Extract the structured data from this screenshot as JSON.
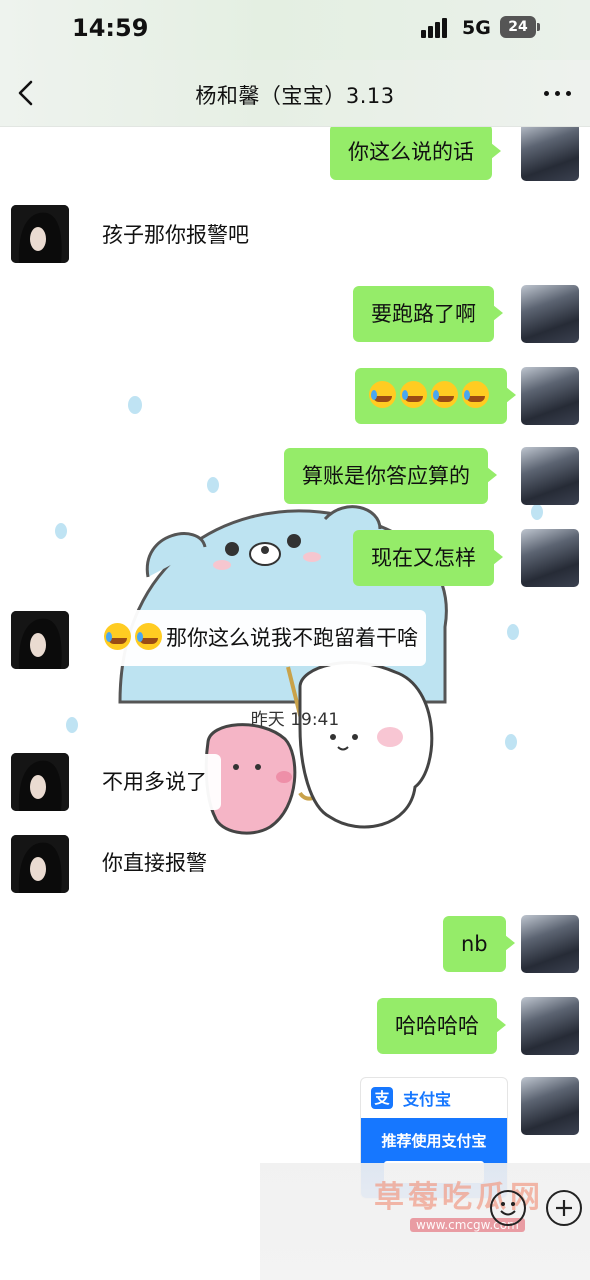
{
  "status_bar": {
    "time": "14:59",
    "network": "5G",
    "battery": "24"
  },
  "nav": {
    "title": "杨和馨（宝宝）3.13",
    "back_icon": "chevron-left-icon",
    "more_icon": "more-dots-icon"
  },
  "messages": [
    {
      "from": "me",
      "text": "你这么说的话"
    },
    {
      "from": "other",
      "text": "孩子那你报警吧"
    },
    {
      "from": "me",
      "text": "要跑路了啊"
    },
    {
      "from": "me",
      "text": "",
      "emojis": 4,
      "emoji_icon": "face-with-tears-of-joy-icon"
    },
    {
      "from": "me",
      "text": "算账是你答应算的"
    },
    {
      "from": "me",
      "text": "现在又怎样"
    },
    {
      "from": "other",
      "text": "那你这么说我不跑留着干啥",
      "emojis": 2,
      "emoji_icon": "face-with-tears-of-joy-icon"
    },
    {
      "from": "other",
      "text": "不用多说了"
    },
    {
      "from": "other",
      "text": "你直接报警"
    },
    {
      "from": "me",
      "text": "nb"
    },
    {
      "from": "me",
      "text": "哈哈哈哈"
    }
  ],
  "timestamp": "昨天 19:41",
  "alipay_card": {
    "logo_char": "支",
    "brand": "支付宝",
    "headline": "推荐使用支付宝"
  },
  "input_bar": {
    "emoji_icon": "emoji-face-icon",
    "plus_icon": "plus-circle-icon"
  },
  "watermark": {
    "text": "草莓吃瓜网",
    "url": "www.cmcgw.com"
  },
  "colors": {
    "outgoing_bubble": "#95ec69",
    "incoming_bubble": "#ffffff",
    "alipay_blue": "#1677ff"
  }
}
